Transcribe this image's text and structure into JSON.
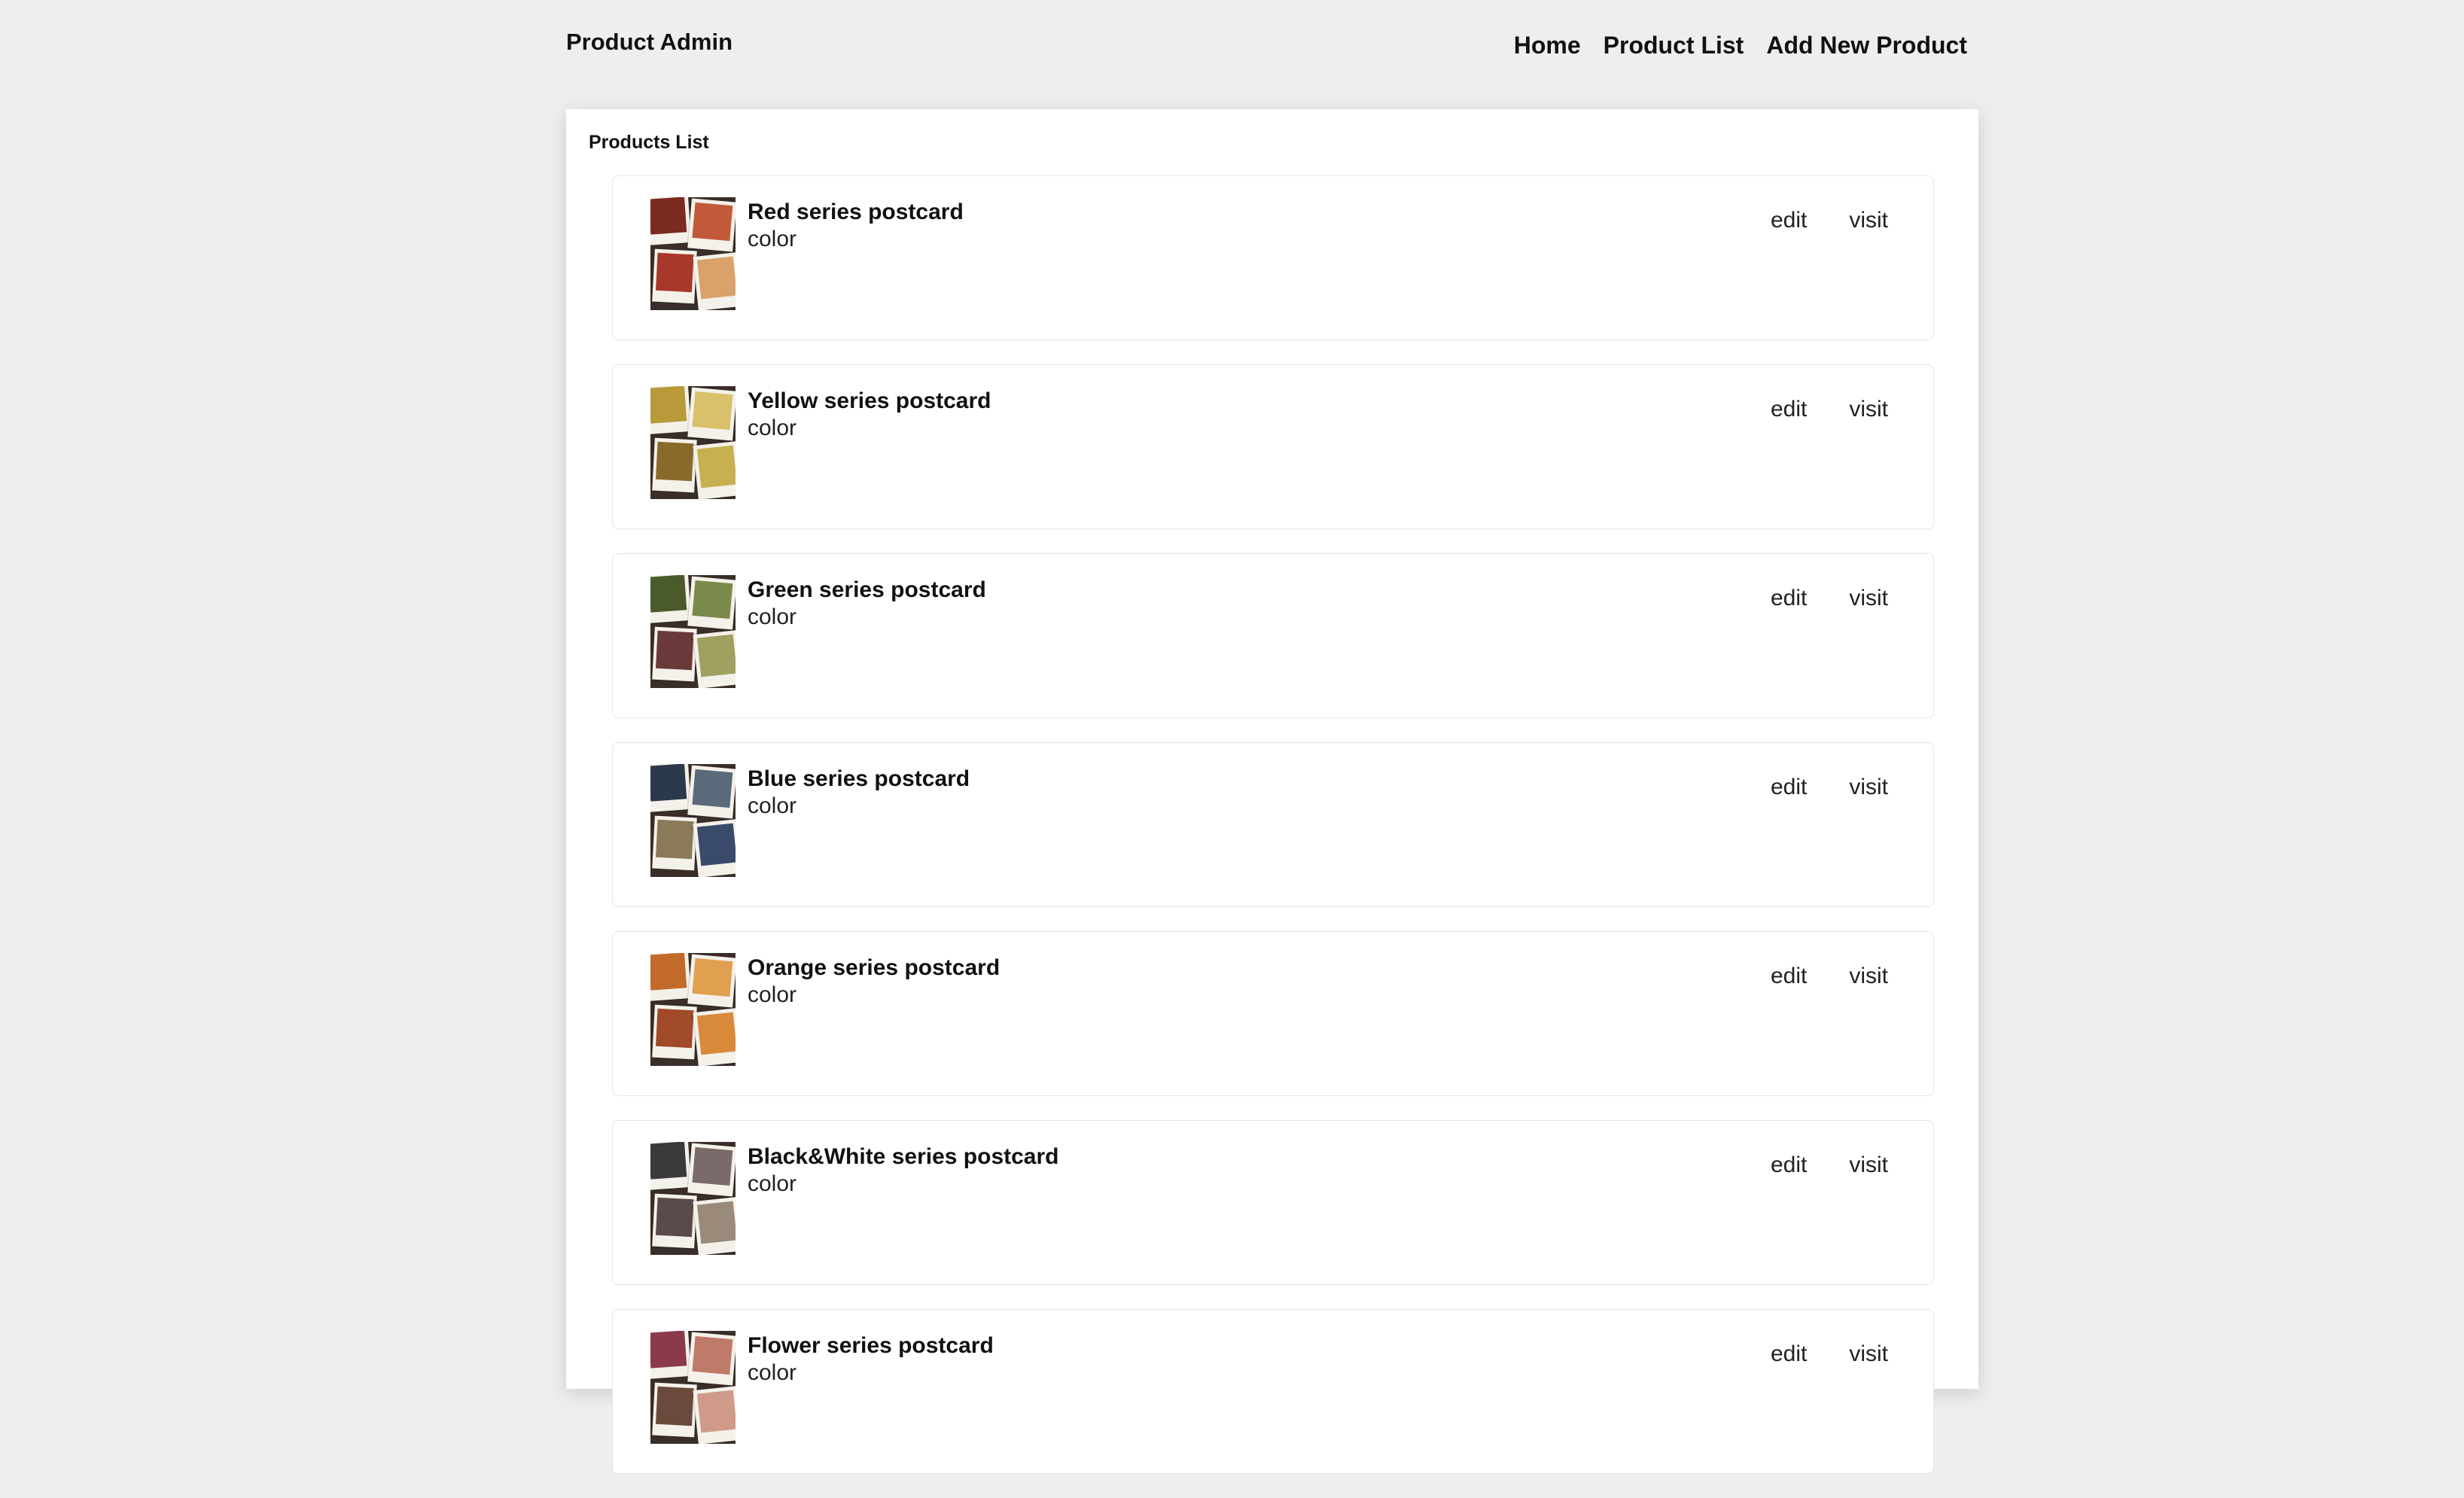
{
  "header": {
    "brand": "Product Admin",
    "nav": [
      "Home",
      "Product List",
      "Add New Product"
    ]
  },
  "panel": {
    "title": "Products List"
  },
  "products": [
    {
      "name": "Red series postcard",
      "category": "color",
      "edit_label": "edit",
      "visit_label": "visit",
      "thumb_colors": [
        "#7a2a1e",
        "#c25a3a",
        "#a8382a",
        "#d8a26a"
      ]
    },
    {
      "name": "Yellow series postcard",
      "category": "color",
      "edit_label": "edit",
      "visit_label": "visit",
      "thumb_colors": [
        "#b89a3a",
        "#d9c06a",
        "#8a6a2a",
        "#c8b050"
      ]
    },
    {
      "name": "Green series postcard",
      "category": "color",
      "edit_label": "edit",
      "visit_label": "visit",
      "thumb_colors": [
        "#4a5a2a",
        "#7a8a4a",
        "#6a3a3a",
        "#a0a060"
      ]
    },
    {
      "name": "Blue series postcard",
      "category": "color",
      "edit_label": "edit",
      "visit_label": "visit",
      "thumb_colors": [
        "#2a3a4a",
        "#5a6a7a",
        "#8a7a5a",
        "#3a4a6a"
      ]
    },
    {
      "name": "Orange series postcard",
      "category": "color",
      "edit_label": "edit",
      "visit_label": "visit",
      "thumb_colors": [
        "#c26a2a",
        "#e0a050",
        "#a04a2a",
        "#d88a3a"
      ]
    },
    {
      "name": "Black&White series postcard",
      "category": "color",
      "edit_label": "edit",
      "visit_label": "visit",
      "thumb_colors": [
        "#3a3a3a",
        "#7a6a6a",
        "#5a4a4a",
        "#9a8a7a"
      ]
    },
    {
      "name": "Flower series postcard",
      "category": "color",
      "edit_label": "edit",
      "visit_label": "visit",
      "thumb_colors": [
        "#8a3a4a",
        "#c07a6a",
        "#6a4a3a",
        "#d09a8a"
      ]
    }
  ]
}
